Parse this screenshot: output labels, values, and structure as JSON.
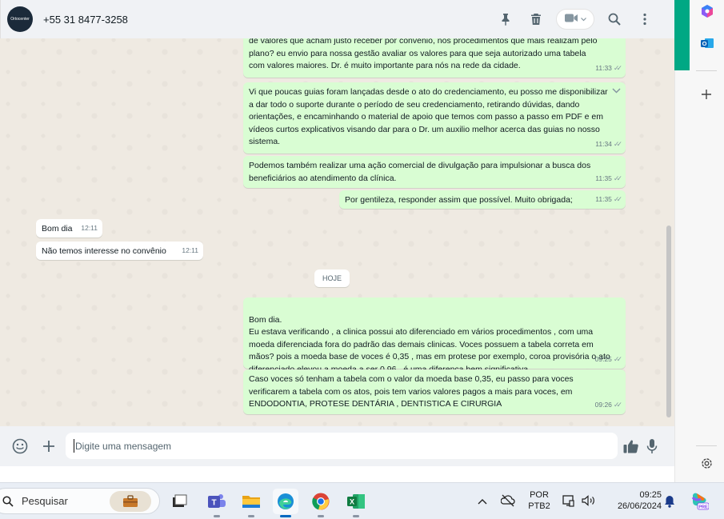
{
  "header": {
    "avatar_text": "Ortocenter",
    "contact_name": "+55 31 8477-3258",
    "icons": [
      "pin-icon",
      "trash-icon",
      "video-call-icon",
      "search-icon",
      "more-options-icon"
    ]
  },
  "messages": [
    {
      "dir": "out",
      "text": "de valores que acham justo receber por convênio, nos procedimentos que mais realizam pelo plano? eu envio para nossa gestão avaliar os valores para que seja autorizado uma tabela com valores maiores. Dr. é muito importante para nós na rede da cidade.",
      "time": "11:33"
    },
    {
      "dir": "out",
      "text": "Vi que poucas guias foram lançadas desde o ato do credenciamento, eu posso me disponibilizar a dar todo o suporte durante o período de seu credenciamento, retirando dúvidas, dando orientações, e encaminhando o material de apoio que temos com passo a passo em PDF e em vídeos curtos explicativos visando dar para o Dr. um auxilio melhor acerca das guias no nosso sistema.",
      "time": "11:34"
    },
    {
      "dir": "out",
      "text": "Podemos também realizar uma ação comercial de divulgação para impulsionar a busca dos beneficiários ao atendimento da clínica.",
      "time": "11:35"
    },
    {
      "dir": "out",
      "text": "Por gentileza, responder assim que possível. Muito obrigada;",
      "time": "11:35"
    },
    {
      "dir": "in",
      "text": "Bom dia",
      "time": "12:11"
    },
    {
      "dir": "in",
      "text": "Não temos interesse no convênio",
      "time": "12:11"
    },
    {
      "dir": "out",
      "text": "Bom dia.\nEu estava verificando , a clinica possui ato diferenciado em vários procedimentos , com uma moeda diferenciada fora do padrão das demais clinicas. Voces possuem a tabela correta em mãos? pois a moeda base de voces é 0,35 , mas em protese por exemplo, coroa provisória o ato diferenciado elevou a moeda a ser 0,96 . é uma diferença bem significativa.",
      "time": "09:25"
    },
    {
      "dir": "out",
      "text": "Caso voces só tenham a tabela com o valor da moeda base 0,35, eu passo para voces verificarem a tabela com os atos, pois tem varios valores pagos a mais para voces, em ENDODONTIA, PROTESE DENTÁRIA , DENTISTICA E CIRURGIA",
      "time": "09:26"
    }
  ],
  "day_chip": "HOJE",
  "composer": {
    "placeholder": "Digite uma mensagem",
    "icons": [
      "emoji-icon",
      "attach-plus-icon",
      "thumbs-up-icon",
      "microphone-icon"
    ]
  },
  "taskbar": {
    "search_placeholder": "Pesquisar",
    "apps": [
      "briefcase-icon",
      "task-view-icon",
      "teams-icon",
      "file-explorer-icon",
      "edge-icon",
      "chrome-icon",
      "excel-icon"
    ],
    "lang_line1": "POR",
    "lang_line2": "PTB2",
    "time": "09:25",
    "date": "26/06/2024"
  },
  "colors": {
    "outgoing_bubble": "#d9fdd3",
    "incoming_bubble": "#ffffff",
    "chat_background": "#efeae2",
    "accent": "#00a884"
  }
}
